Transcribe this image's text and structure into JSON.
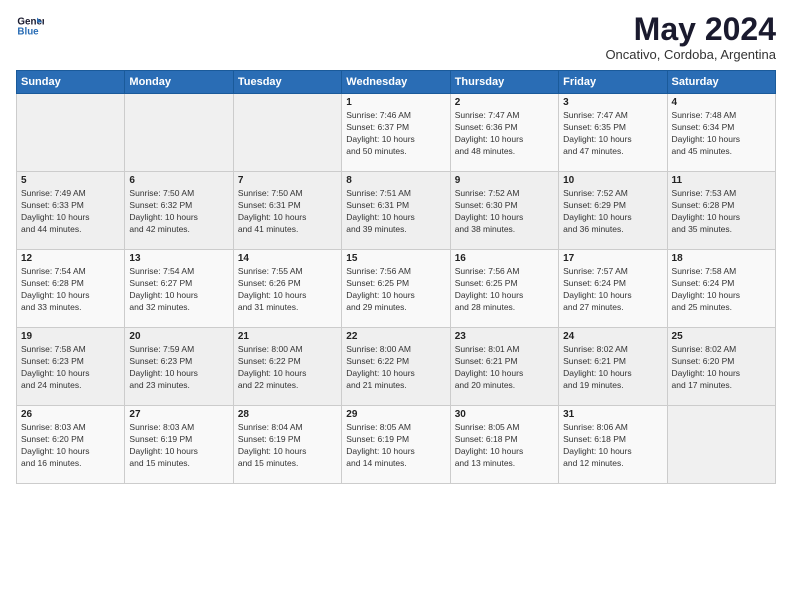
{
  "header": {
    "logo_line1": "General",
    "logo_line2": "Blue",
    "title": "May 2024",
    "subtitle": "Oncativo, Cordoba, Argentina"
  },
  "days_of_week": [
    "Sunday",
    "Monday",
    "Tuesday",
    "Wednesday",
    "Thursday",
    "Friday",
    "Saturday"
  ],
  "weeks": [
    [
      {
        "num": "",
        "info": ""
      },
      {
        "num": "",
        "info": ""
      },
      {
        "num": "",
        "info": ""
      },
      {
        "num": "1",
        "info": "Sunrise: 7:46 AM\nSunset: 6:37 PM\nDaylight: 10 hours\nand 50 minutes."
      },
      {
        "num": "2",
        "info": "Sunrise: 7:47 AM\nSunset: 6:36 PM\nDaylight: 10 hours\nand 48 minutes."
      },
      {
        "num": "3",
        "info": "Sunrise: 7:47 AM\nSunset: 6:35 PM\nDaylight: 10 hours\nand 47 minutes."
      },
      {
        "num": "4",
        "info": "Sunrise: 7:48 AM\nSunset: 6:34 PM\nDaylight: 10 hours\nand 45 minutes."
      }
    ],
    [
      {
        "num": "5",
        "info": "Sunrise: 7:49 AM\nSunset: 6:33 PM\nDaylight: 10 hours\nand 44 minutes."
      },
      {
        "num": "6",
        "info": "Sunrise: 7:50 AM\nSunset: 6:32 PM\nDaylight: 10 hours\nand 42 minutes."
      },
      {
        "num": "7",
        "info": "Sunrise: 7:50 AM\nSunset: 6:31 PM\nDaylight: 10 hours\nand 41 minutes."
      },
      {
        "num": "8",
        "info": "Sunrise: 7:51 AM\nSunset: 6:31 PM\nDaylight: 10 hours\nand 39 minutes."
      },
      {
        "num": "9",
        "info": "Sunrise: 7:52 AM\nSunset: 6:30 PM\nDaylight: 10 hours\nand 38 minutes."
      },
      {
        "num": "10",
        "info": "Sunrise: 7:52 AM\nSunset: 6:29 PM\nDaylight: 10 hours\nand 36 minutes."
      },
      {
        "num": "11",
        "info": "Sunrise: 7:53 AM\nSunset: 6:28 PM\nDaylight: 10 hours\nand 35 minutes."
      }
    ],
    [
      {
        "num": "12",
        "info": "Sunrise: 7:54 AM\nSunset: 6:28 PM\nDaylight: 10 hours\nand 33 minutes."
      },
      {
        "num": "13",
        "info": "Sunrise: 7:54 AM\nSunset: 6:27 PM\nDaylight: 10 hours\nand 32 minutes."
      },
      {
        "num": "14",
        "info": "Sunrise: 7:55 AM\nSunset: 6:26 PM\nDaylight: 10 hours\nand 31 minutes."
      },
      {
        "num": "15",
        "info": "Sunrise: 7:56 AM\nSunset: 6:25 PM\nDaylight: 10 hours\nand 29 minutes."
      },
      {
        "num": "16",
        "info": "Sunrise: 7:56 AM\nSunset: 6:25 PM\nDaylight: 10 hours\nand 28 minutes."
      },
      {
        "num": "17",
        "info": "Sunrise: 7:57 AM\nSunset: 6:24 PM\nDaylight: 10 hours\nand 27 minutes."
      },
      {
        "num": "18",
        "info": "Sunrise: 7:58 AM\nSunset: 6:24 PM\nDaylight: 10 hours\nand 25 minutes."
      }
    ],
    [
      {
        "num": "19",
        "info": "Sunrise: 7:58 AM\nSunset: 6:23 PM\nDaylight: 10 hours\nand 24 minutes."
      },
      {
        "num": "20",
        "info": "Sunrise: 7:59 AM\nSunset: 6:23 PM\nDaylight: 10 hours\nand 23 minutes."
      },
      {
        "num": "21",
        "info": "Sunrise: 8:00 AM\nSunset: 6:22 PM\nDaylight: 10 hours\nand 22 minutes."
      },
      {
        "num": "22",
        "info": "Sunrise: 8:00 AM\nSunset: 6:22 PM\nDaylight: 10 hours\nand 21 minutes."
      },
      {
        "num": "23",
        "info": "Sunrise: 8:01 AM\nSunset: 6:21 PM\nDaylight: 10 hours\nand 20 minutes."
      },
      {
        "num": "24",
        "info": "Sunrise: 8:02 AM\nSunset: 6:21 PM\nDaylight: 10 hours\nand 19 minutes."
      },
      {
        "num": "25",
        "info": "Sunrise: 8:02 AM\nSunset: 6:20 PM\nDaylight: 10 hours\nand 17 minutes."
      }
    ],
    [
      {
        "num": "26",
        "info": "Sunrise: 8:03 AM\nSunset: 6:20 PM\nDaylight: 10 hours\nand 16 minutes."
      },
      {
        "num": "27",
        "info": "Sunrise: 8:03 AM\nSunset: 6:19 PM\nDaylight: 10 hours\nand 15 minutes."
      },
      {
        "num": "28",
        "info": "Sunrise: 8:04 AM\nSunset: 6:19 PM\nDaylight: 10 hours\nand 15 minutes."
      },
      {
        "num": "29",
        "info": "Sunrise: 8:05 AM\nSunset: 6:19 PM\nDaylight: 10 hours\nand 14 minutes."
      },
      {
        "num": "30",
        "info": "Sunrise: 8:05 AM\nSunset: 6:18 PM\nDaylight: 10 hours\nand 13 minutes."
      },
      {
        "num": "31",
        "info": "Sunrise: 8:06 AM\nSunset: 6:18 PM\nDaylight: 10 hours\nand 12 minutes."
      },
      {
        "num": "",
        "info": ""
      }
    ]
  ]
}
